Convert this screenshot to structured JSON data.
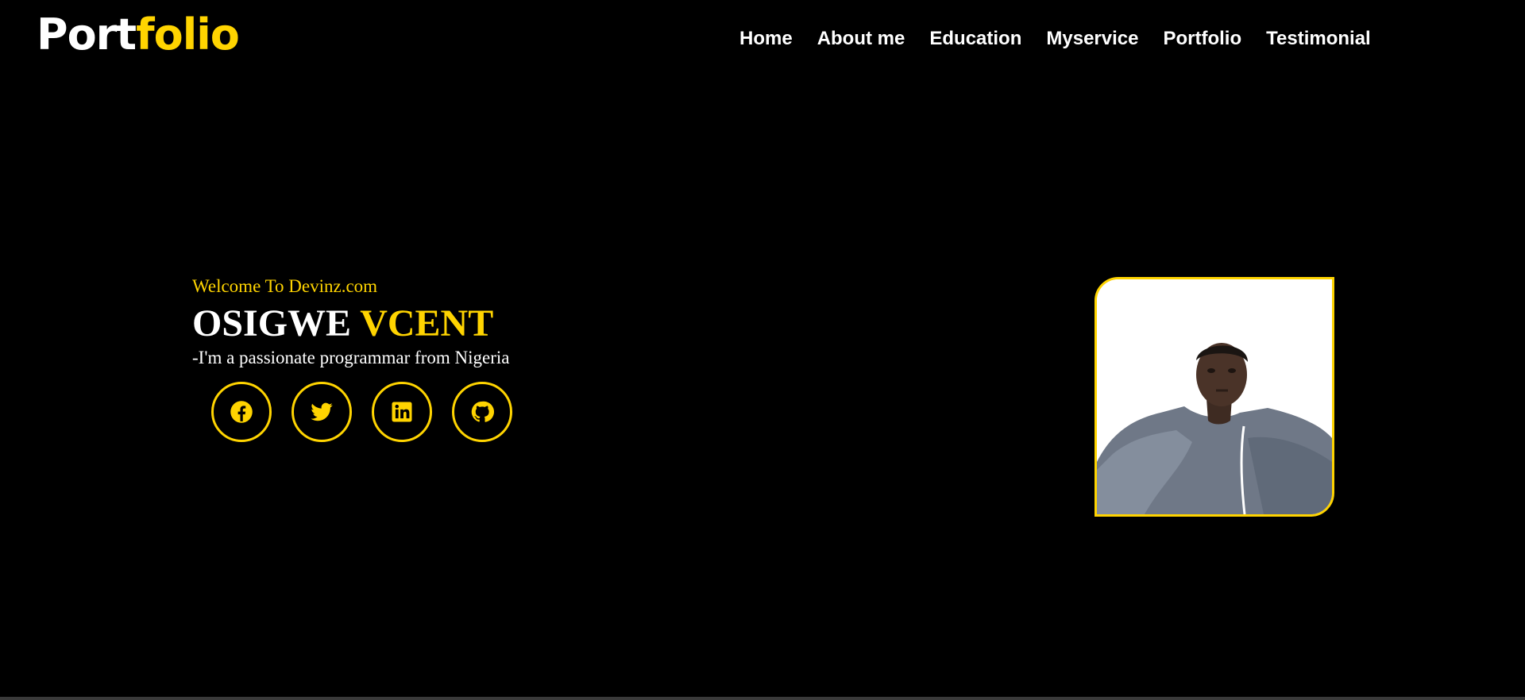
{
  "header": {
    "logo": {
      "part1": "Port",
      "part2": "folio"
    },
    "nav": [
      "Home",
      "About me",
      "Education",
      "Myservice",
      "Portfolio",
      "Testimonial"
    ]
  },
  "hero": {
    "welcome": "Welcome To Devinz.com",
    "name_first": "OSIGWE",
    "name_last": "VCENT",
    "tagline": "-I'm a passionate programmar from Nigeria",
    "socials": [
      "facebook-icon",
      "twitter-icon",
      "linkedin-icon",
      "github-icon"
    ]
  },
  "colors": {
    "background": "#000000",
    "accent": "#ffd400",
    "text": "#ffffff"
  }
}
